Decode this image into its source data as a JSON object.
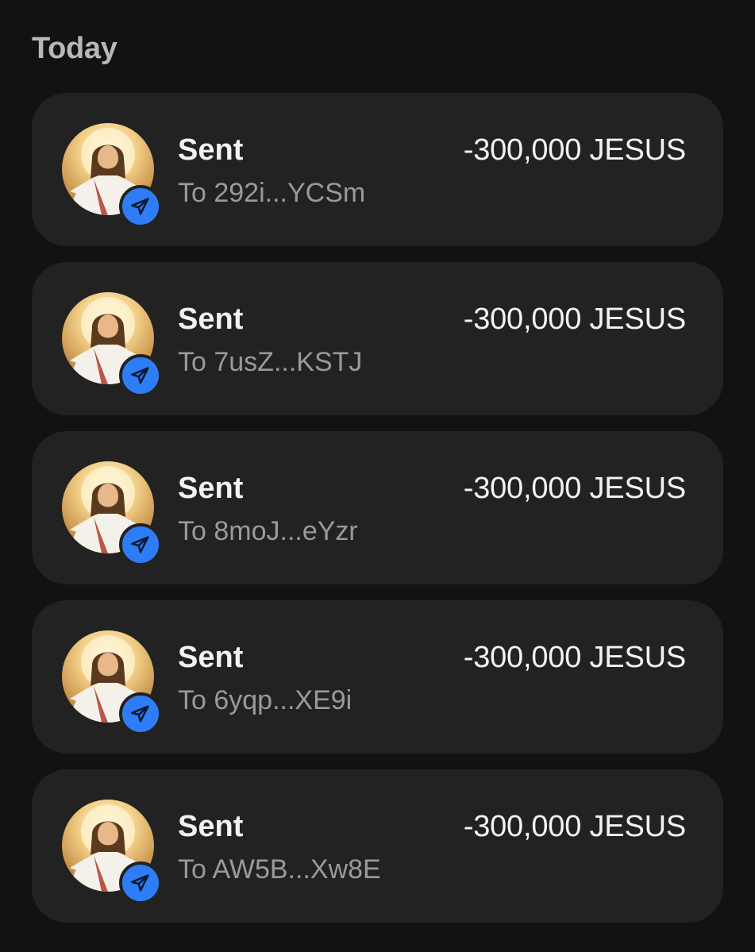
{
  "section": {
    "title": "Today"
  },
  "transactions": [
    {
      "label": "Sent",
      "recipient": "To 292i...YCSm",
      "amount": "-300,000 JESUS",
      "avatar_icon": "token-avatar",
      "badge_icon": "send-icon"
    },
    {
      "label": "Sent",
      "recipient": "To 7usZ...KSTJ",
      "amount": "-300,000 JESUS",
      "avatar_icon": "token-avatar",
      "badge_icon": "send-icon"
    },
    {
      "label": "Sent",
      "recipient": "To 8moJ...eYzr",
      "amount": "-300,000 JESUS",
      "avatar_icon": "token-avatar",
      "badge_icon": "send-icon"
    },
    {
      "label": "Sent",
      "recipient": "To 6yqp...XE9i",
      "amount": "-300,000 JESUS",
      "avatar_icon": "token-avatar",
      "badge_icon": "send-icon"
    },
    {
      "label": "Sent",
      "recipient": "To AW5B...Xw8E",
      "amount": "-300,000 JESUS",
      "avatar_icon": "token-avatar",
      "badge_icon": "send-icon"
    }
  ],
  "colors": {
    "background": "#121212",
    "card": "#222222",
    "badge": "#2f7df6",
    "primary_text": "#f2f2f2",
    "secondary_text": "#9a9a9a",
    "header_text": "#b8b8b8"
  }
}
